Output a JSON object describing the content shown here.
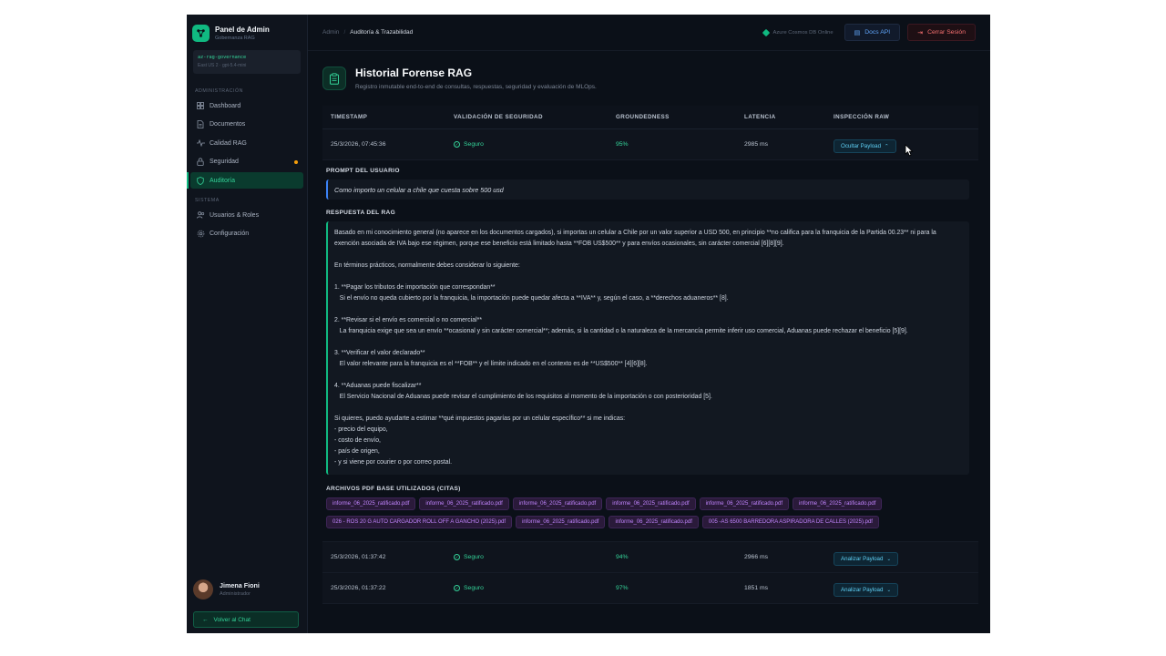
{
  "sidebar": {
    "brand_title": "Panel de Admin",
    "brand_subtitle": "Gobernanza RAG",
    "index_name": "az-rag-governance",
    "index_meta": "East US 2 · gpt-5.4-mini",
    "section_admin": "ADMINISTRACIÓN",
    "section_system": "SISTEMA",
    "items": [
      {
        "label": "Dashboard",
        "icon": "grid-icon"
      },
      {
        "label": "Documentos",
        "icon": "document-icon"
      },
      {
        "label": "Calidad RAG",
        "icon": "pulse-icon"
      },
      {
        "label": "Seguridad",
        "icon": "lock-icon"
      },
      {
        "label": "Auditoría",
        "icon": "shield-icon",
        "active": true
      }
    ],
    "system_items": [
      {
        "label": "Usuarios & Roles",
        "icon": "users-icon"
      },
      {
        "label": "Configuración",
        "icon": "gear-icon"
      }
    ],
    "user_name": "Jimena Fioni",
    "user_role": "Administrador",
    "back_label": "Volver al Chat"
  },
  "topbar": {
    "breadcrumb_root": "Admin",
    "breadcrumb_current": "Auditoría & Trazabilidad",
    "azure_label": "Azure Cosmos DB Online",
    "docs_label": "Docs API",
    "logout_label": "Cerrar Sesión"
  },
  "page": {
    "title": "Historial Forense RAG",
    "subtitle": "Registro inmutable end-to-end de consultas, respuestas, seguridad y evaluación de MLOps."
  },
  "table": {
    "headers": [
      "TIMESTAMP",
      "VALIDACIÓN DE SEGURIDAD",
      "GROUNDEDNESS",
      "LATENCIA",
      "INSPECCIÓN RAW"
    ],
    "rows": [
      {
        "timestamp": "25/3/2026, 07:45:36",
        "security": "Seguro",
        "groundedness": "95%",
        "latency": "2985 ms",
        "action": "Ocultar Payload",
        "chevron": "⌃"
      },
      {
        "timestamp": "25/3/2026, 01:37:42",
        "security": "Seguro",
        "groundedness": "94%",
        "latency": "2966 ms",
        "action": "Analizar Payload",
        "chevron": "⌄"
      },
      {
        "timestamp": "25/3/2026, 01:37:22",
        "security": "Seguro",
        "groundedness": "97%",
        "latency": "1851 ms",
        "action": "Analizar Payload",
        "chevron": "⌄"
      }
    ]
  },
  "detail": {
    "prompt_label": "PROMPT DEL USUARIO",
    "prompt_text": "Como importo un celular a chile que cuesta sobre 500 usd",
    "response_label": "RESPUESTA DEL RAG",
    "response_paragraphs": [
      "Basado en mi conocimiento general (no aparece en los documentos cargados), si importas un celular a Chile por un valor superior a USD 500, en principio **no califica para la franquicia de la Partida 00.23** ni para la exención asociada de IVA bajo ese régimen, porque ese beneficio está limitado hasta **FOB US$500** y para envíos ocasionales, sin carácter comercial [6][8][9].",
      "En términos prácticos, normalmente debes considerar lo siguiente:",
      "1. **Pagar los tributos de importación que correspondan**\n   Si el envío no queda cubierto por la franquicia, la importación puede quedar afecta a **IVA** y, según el caso, a **derechos aduaneros** [8].",
      "2. **Revisar si el envío es comercial o no comercial**\n   La franquicia exige que sea un envío **ocasional y sin carácter comercial**; además, si la cantidad o la naturaleza de la mercancía permite inferir uso comercial, Aduanas puede rechazar el beneficio [5][9].",
      "3. **Verificar el valor declarado**\n   El valor relevante para la franquicia es el **FOB** y el límite indicado en el contexto es de **US$500** [4][6][8].",
      "4. **Aduanas puede fiscalizar**\n   El Servicio Nacional de Aduanas puede revisar el cumplimiento de los requisitos al momento de la importación o con posterioridad [5].",
      "Si quieres, puedo ayudarte a estimar **qué impuestos pagarías por un celular específico** si me indicas:\n- precio del equipo,\n- costo de envío,\n- país de origen,\n- y si viene por courier o por correo postal."
    ],
    "citations_label": "ARCHIVOS PDF BASE UTILIZADOS (CITAS)",
    "citations": [
      "informe_06_2025_ratificado.pdf",
      "informe_06_2025_ratificado.pdf",
      "informe_06_2025_ratificado.pdf",
      "informe_06_2025_ratificado.pdf",
      "informe_06_2025_ratificado.pdf",
      "informe_06_2025_ratificado.pdf",
      "026 - ROS 20 G AUTO CARGADOR ROLL OFF A GANCHO (2025).pdf",
      "informe_06_2025_ratificado.pdf",
      "informe_06_2025_ratificado.pdf",
      "005 -AS 6500 BARREDORA ASPIRADORA DE CALLES (2025).pdf"
    ]
  },
  "colors": {
    "accent": "#10b981",
    "background": "#0b1018",
    "citation": "#c084fc",
    "payload": "#5fd0f5",
    "danger": "#f87171",
    "link": "#60a5fa"
  }
}
